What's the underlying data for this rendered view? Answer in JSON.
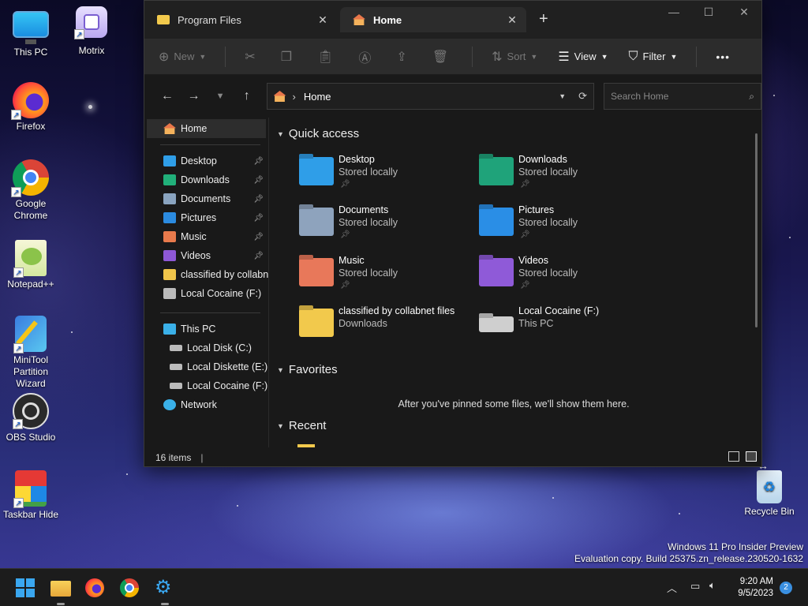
{
  "desktop": {
    "icons": [
      {
        "label": "This PC"
      },
      {
        "label": "Motrix"
      },
      {
        "label": "Firefox"
      },
      {
        "label": "Google Chrome"
      },
      {
        "label": "Notepad++"
      },
      {
        "label": "MiniTool Partition Wizard"
      },
      {
        "label": "OBS Studio"
      },
      {
        "label": "Taskbar Hide"
      },
      {
        "label": "Recycle Bin"
      }
    ]
  },
  "explorer": {
    "tabs": [
      {
        "label": "Program Files",
        "active": false
      },
      {
        "label": "Home",
        "active": true
      }
    ],
    "new_tab": "+",
    "window_controls": {
      "minimize": "—",
      "maximize": "☐",
      "close": "✕"
    },
    "toolbar": {
      "new": "New",
      "sort": "Sort",
      "view": "View",
      "filter": "Filter",
      "more": "•••"
    },
    "address": {
      "location": "Home",
      "search_placeholder": "Search Home"
    },
    "sidebar": {
      "home": "Home",
      "pinned": [
        {
          "label": "Desktop",
          "pinned": true,
          "color": "#2f9ee8"
        },
        {
          "label": "Downloads",
          "pinned": true,
          "color": "#21b07a"
        },
        {
          "label": "Documents",
          "pinned": true,
          "color": "#8aa4c0"
        },
        {
          "label": "Pictures",
          "pinned": true,
          "color": "#2b8be0"
        },
        {
          "label": "Music",
          "pinned": true,
          "color": "#e87a4c"
        },
        {
          "label": "Videos",
          "pinned": true,
          "color": "#8e58d6"
        },
        {
          "label": "classified by collabnet files",
          "pinned": false,
          "color": "#f0c54a"
        },
        {
          "label": "Local Cocaine (F:)",
          "pinned": false,
          "color": "#bbbbbb"
        }
      ],
      "this_pc": "This PC",
      "drives": [
        {
          "label": "Local Disk (C:)"
        },
        {
          "label": "Local Diskette (E:)"
        },
        {
          "label": "Local Cocaine (F:)"
        }
      ],
      "network": "Network"
    },
    "sections": {
      "quick_access": "Quick access",
      "favorites": "Favorites",
      "favorites_empty": "After you've pinned some files, we'll show them here.",
      "recent": "Recent"
    },
    "quick_access": [
      {
        "name": "Desktop",
        "sub": "Stored locally",
        "pinned": true,
        "color": "#2f9ee8"
      },
      {
        "name": "Downloads",
        "sub": "Stored locally",
        "pinned": true,
        "color": "#1fa37a"
      },
      {
        "name": "Documents",
        "sub": "Stored locally",
        "pinned": true,
        "color": "#8ea3bd"
      },
      {
        "name": "Pictures",
        "sub": "Stored locally",
        "pinned": true,
        "color": "#2a8ee6"
      },
      {
        "name": "Music",
        "sub": "Stored locally",
        "pinned": true,
        "color": "#e8785a"
      },
      {
        "name": "Videos",
        "sub": "Stored locally",
        "pinned": true,
        "color": "#8f5ad8"
      },
      {
        "name": "classified by collabnet files",
        "sub": "Downloads",
        "pinned": false,
        "color": "#f2c94c"
      },
      {
        "name": "Local Cocaine (F:)",
        "sub": "This PC",
        "pinned": false,
        "color": "#cfcfcf"
      }
    ],
    "status": {
      "item_count": "16 items"
    }
  },
  "watermark": {
    "line1": "Windows 11 Pro Insider Preview",
    "line2": "Evaluation copy. Build 25375.zn_release.230520-1632"
  },
  "taskbar": {
    "apps": [
      "start-icon",
      "file-explorer-icon",
      "firefox-icon",
      "chrome-icon",
      "settings-icon"
    ],
    "time": "9:20 AM",
    "date": "9/5/2023",
    "notifications": "2"
  }
}
